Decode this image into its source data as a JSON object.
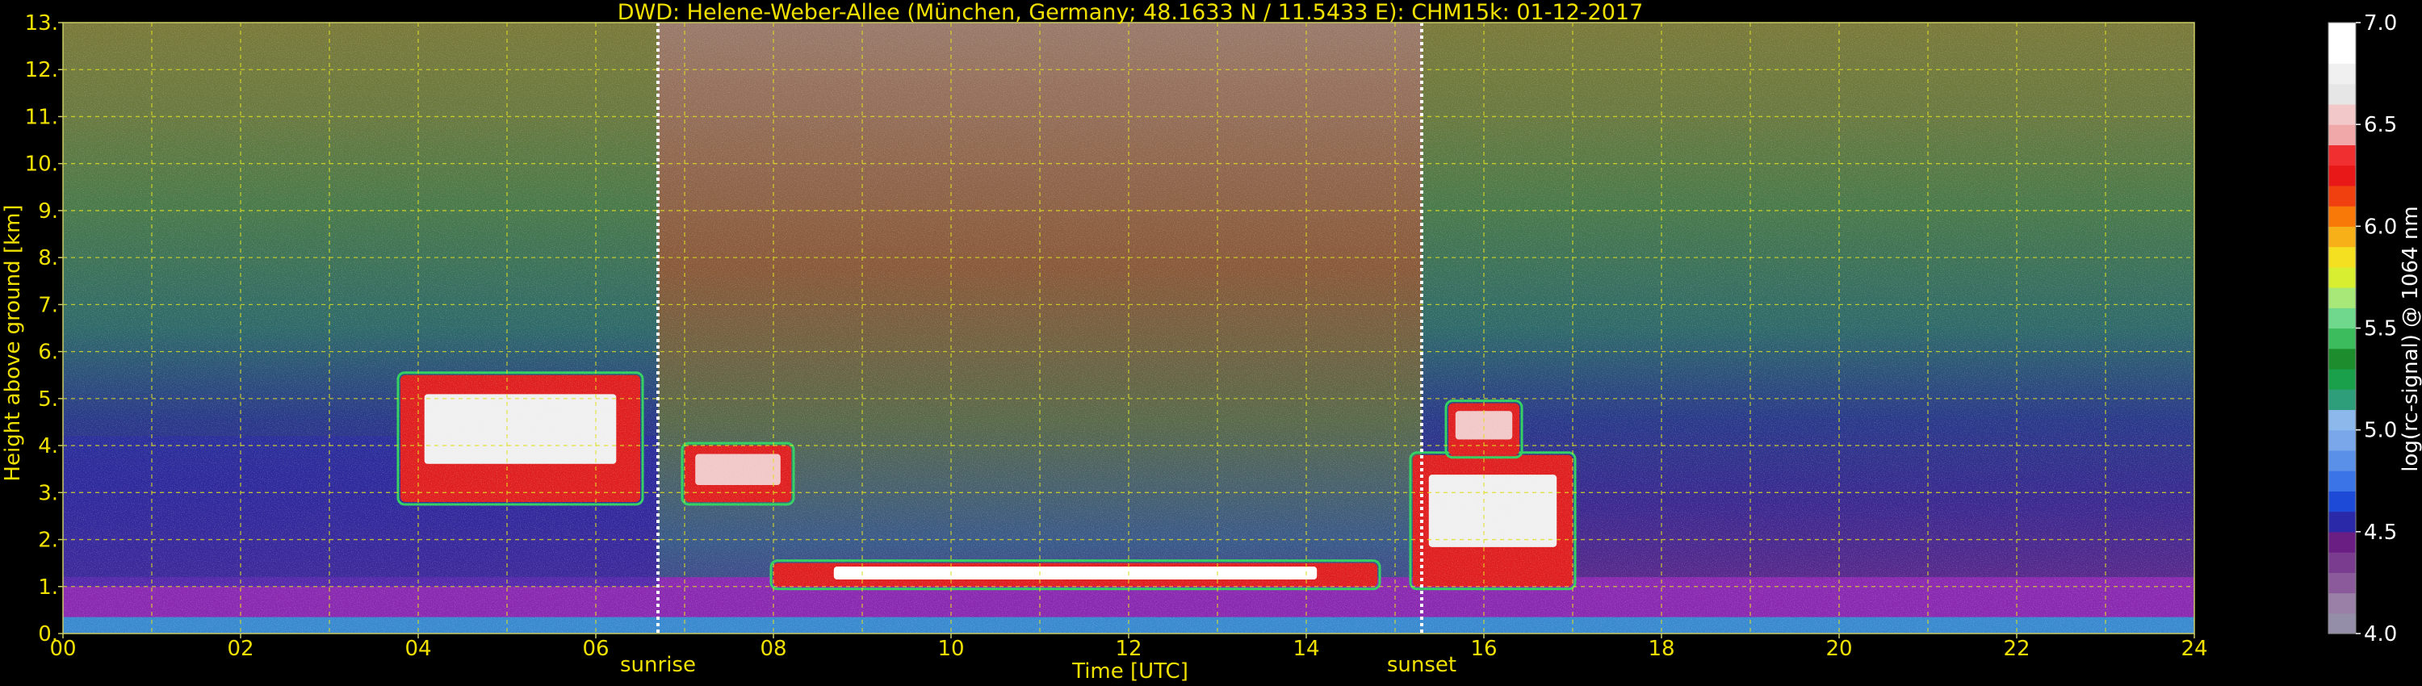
{
  "chart_data": {
    "type": "heatmap",
    "title": "DWD: Helene-Weber-Allee (München, Germany; 48.1633 N / 11.5433 E):    CHM15k: 01-12-2017",
    "xlabel": "Time [UTC]",
    "ylabel": "Height above ground [km]",
    "xlim": [
      0,
      24
    ],
    "ylim": [
      0,
      13
    ],
    "x_ticks": [
      "00",
      "02",
      "04",
      "06",
      "08",
      "10",
      "12",
      "14",
      "16",
      "18",
      "20",
      "22",
      "24"
    ],
    "y_ticks": [
      "0.",
      "1.",
      "2.",
      "3.",
      "4.",
      "5.",
      "6.",
      "7.",
      "8.",
      "9.",
      "10.",
      "11.",
      "12.",
      "13."
    ],
    "grid": true,
    "markers": [
      {
        "label": "sunrise",
        "time": 6.7
      },
      {
        "label": "sunset",
        "time": 15.3
      }
    ],
    "colorbar": {
      "label": "log(rc-signal) @ 1064 nm",
      "range": [
        4.0,
        7.0
      ],
      "ticks": [
        "4.0",
        "4.5",
        "5.0",
        "5.5",
        "6.0",
        "6.5",
        "7.0"
      ],
      "colors": [
        "#948ea8",
        "#9a7fa6",
        "#8a5a9a",
        "#7a3c8e",
        "#6a1e84",
        "#2a2aa8",
        "#1e4ad8",
        "#3a74e6",
        "#5a90e8",
        "#7aa6ea",
        "#8cb8ec",
        "#2e9e7a",
        "#1aa04a",
        "#1c8c2c",
        "#3cbc5c",
        "#70d88c",
        "#a8e878",
        "#d8ee30",
        "#f4e020",
        "#f8b018",
        "#f87808",
        "#f04010",
        "#e81818",
        "#f03030",
        "#f0a8a8",
        "#f2c8c8",
        "#e6e6e6",
        "#f0f0f0",
        "#ffffff",
        "#ffffff"
      ]
    },
    "features": [
      {
        "kind": "boundary_layer_aerosol",
        "t_start": 0,
        "t_end": 24,
        "height_km": [
          0.1,
          1.2
        ],
        "level": 5.0
      },
      {
        "kind": "residual_layer",
        "t_start": 0,
        "t_end": 6.7,
        "height_km": [
          1.0,
          4.2
        ],
        "level": 4.6
      },
      {
        "kind": "cloud",
        "t_start": 3.8,
        "t_end": 6.5,
        "height_km": [
          2.8,
          5.5
        ],
        "level": 6.8
      },
      {
        "kind": "cloud",
        "t_start": 7.0,
        "t_end": 8.2,
        "height_km": [
          2.8,
          4.0
        ],
        "level": 6.5
      },
      {
        "kind": "cloud",
        "t_start": 8.0,
        "t_end": 14.8,
        "height_km": [
          1.0,
          1.5
        ],
        "level": 6.9
      },
      {
        "kind": "cloud",
        "t_start": 15.2,
        "t_end": 17.0,
        "height_km": [
          1.0,
          3.8
        ],
        "level": 6.8
      },
      {
        "kind": "cloud",
        "t_start": 15.6,
        "t_end": 16.4,
        "height_km": [
          3.8,
          4.9
        ],
        "level": 6.5
      }
    ]
  }
}
